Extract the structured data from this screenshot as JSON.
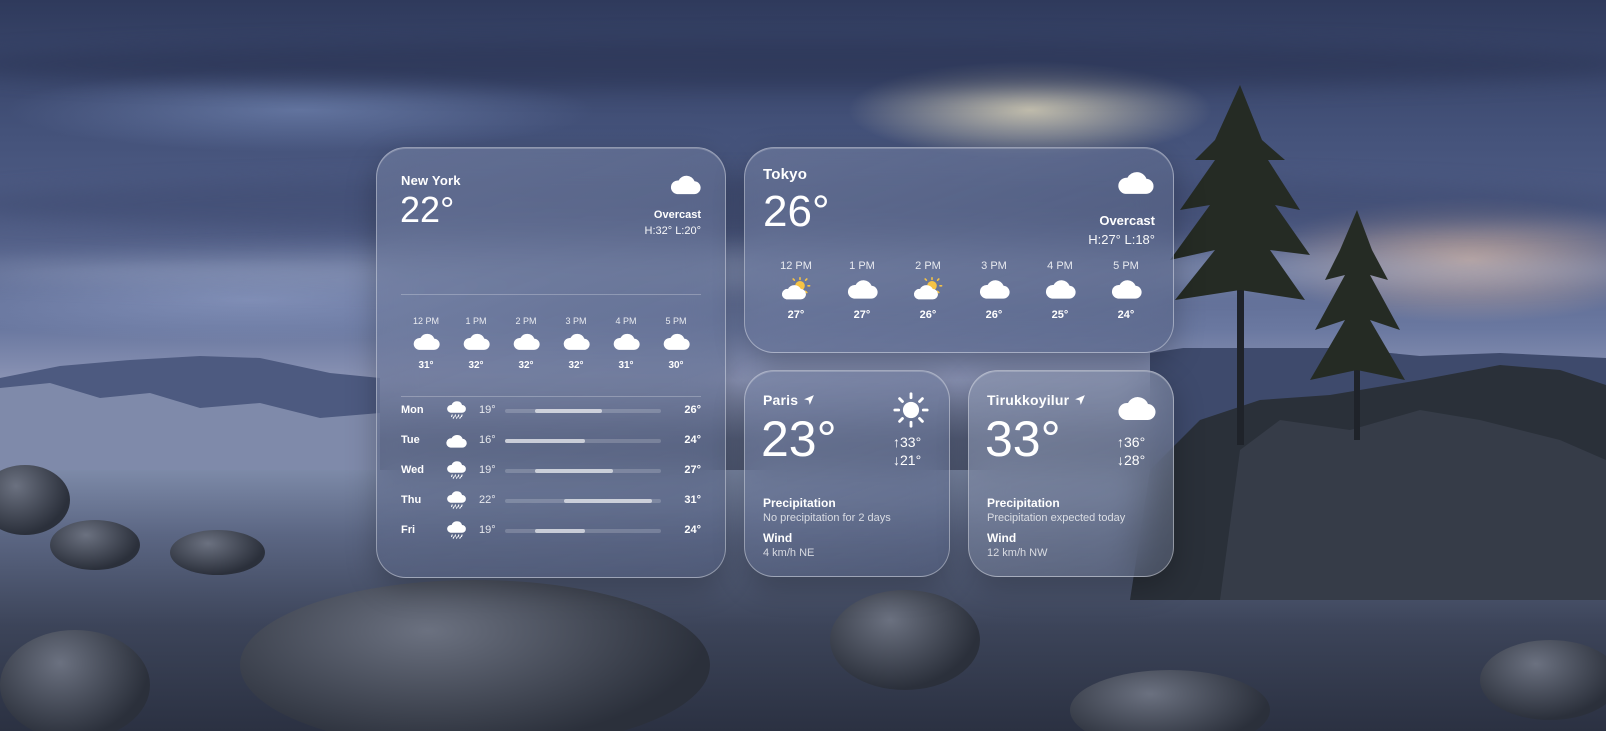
{
  "background": {
    "scene": "lake-at-dusk"
  },
  "new_york": {
    "city": "New York",
    "temp": "22°",
    "condition": "Overcast",
    "high_low": "H:32°  L:20°",
    "current_icon": "cloud-icon",
    "hourly": [
      {
        "time": "12 PM",
        "icon": "cloud-icon",
        "temp": "31°"
      },
      {
        "time": "1 PM",
        "icon": "cloud-icon",
        "temp": "32°"
      },
      {
        "time": "2 PM",
        "icon": "cloud-icon",
        "temp": "32°"
      },
      {
        "time": "3 PM",
        "icon": "cloud-icon",
        "temp": "32°"
      },
      {
        "time": "4 PM",
        "icon": "cloud-icon",
        "temp": "31°"
      },
      {
        "time": "5 PM",
        "icon": "cloud-icon",
        "temp": "30°"
      }
    ],
    "daily": [
      {
        "day": "Mon",
        "icon": "cloud-rain-icon",
        "low": "19°",
        "high": "26°",
        "range": [
          0.19,
          0.62
        ]
      },
      {
        "day": "Tue",
        "icon": "cloud-icon",
        "low": "16°",
        "high": "24°",
        "range": [
          0.0,
          0.51
        ]
      },
      {
        "day": "Wed",
        "icon": "cloud-rain-icon",
        "low": "19°",
        "high": "27°",
        "range": [
          0.19,
          0.69
        ]
      },
      {
        "day": "Thu",
        "icon": "cloud-rain-icon",
        "low": "22°",
        "high": "31°",
        "range": [
          0.38,
          0.94
        ]
      },
      {
        "day": "Fri",
        "icon": "cloud-rain-icon",
        "low": "19°",
        "high": "24°",
        "range": [
          0.19,
          0.51
        ]
      }
    ]
  },
  "tokyo": {
    "city": "Tokyo",
    "temp": "26°",
    "condition": "Overcast",
    "high_low": "H:27°  L:18°",
    "current_icon": "cloud-icon",
    "hourly": [
      {
        "time": "12 PM",
        "icon": "partly-sunny-icon",
        "temp": "27°"
      },
      {
        "time": "1 PM",
        "icon": "cloud-icon",
        "temp": "27°"
      },
      {
        "time": "2 PM",
        "icon": "partly-sunny-icon",
        "temp": "26°"
      },
      {
        "time": "3 PM",
        "icon": "cloud-icon",
        "temp": "26°"
      },
      {
        "time": "4 PM",
        "icon": "cloud-icon",
        "temp": "25°"
      },
      {
        "time": "5 PM",
        "icon": "cloud-icon",
        "temp": "24°"
      }
    ]
  },
  "paris": {
    "city": "Paris",
    "location_icon": "location-arrow-icon",
    "temp": "23°",
    "current_icon": "sun-icon",
    "high": "33°",
    "low": "21°",
    "precip_label": "Precipitation",
    "precip_text": "No precipitation for 2 days",
    "wind_label": "Wind",
    "wind_text": "4 km/h NE"
  },
  "tirukkoyilur": {
    "city": "Tirukkoyilur",
    "location_icon": "location-arrow-icon",
    "temp": "33°",
    "current_icon": "cloud-icon",
    "high": "36°",
    "low": "28°",
    "precip_label": "Precipitation",
    "precip_text": "Precipitation expected today",
    "wind_label": "Wind",
    "wind_text": "12 km/h NW"
  }
}
